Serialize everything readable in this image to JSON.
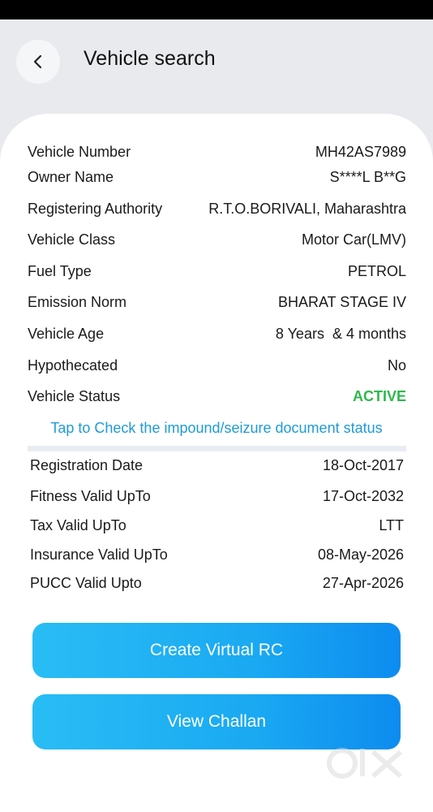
{
  "header": {
    "title": "Vehicle search"
  },
  "details": [
    {
      "label": "Vehicle Number",
      "value": "MH42AS7989"
    },
    {
      "label": "Owner Name",
      "value": "S****L B**G"
    },
    {
      "label": "Registering Authority",
      "value": "R.T.O.BORIVALI, Maharashtra"
    },
    {
      "label": "Vehicle Class",
      "value": "Motor Car(LMV)"
    },
    {
      "label": "Fuel Type",
      "value": "PETROL"
    },
    {
      "label": "Emission Norm",
      "value": "BHARAT STAGE IV"
    },
    {
      "label": "Vehicle Age",
      "value": "8 Years  & 4 months"
    },
    {
      "label": "Hypothecated",
      "value": "No"
    },
    {
      "label": "Vehicle Status",
      "value": "ACTIVE"
    }
  ],
  "impound_link": "Tap to Check the impound/seizure document status",
  "validity": [
    {
      "label": "Registration Date",
      "value": "18-Oct-2017"
    },
    {
      "label": "Fitness Valid UpTo",
      "value": "17-Oct-2032"
    },
    {
      "label": "Tax Valid UpTo",
      "value": "LTT"
    },
    {
      "label": "Insurance Valid UpTo",
      "value": "08-May-2026"
    },
    {
      "label": "PUCC Valid Upto",
      "value": "27-Apr-2026"
    }
  ],
  "buttons": {
    "create_rc": "Create Virtual RC",
    "view_challan": "View Challan"
  },
  "colors": {
    "status_active": "#2eb84b",
    "link": "#1e9bd6",
    "button_gradient_start": "#29bdf5",
    "button_gradient_end": "#0d8cf0"
  }
}
